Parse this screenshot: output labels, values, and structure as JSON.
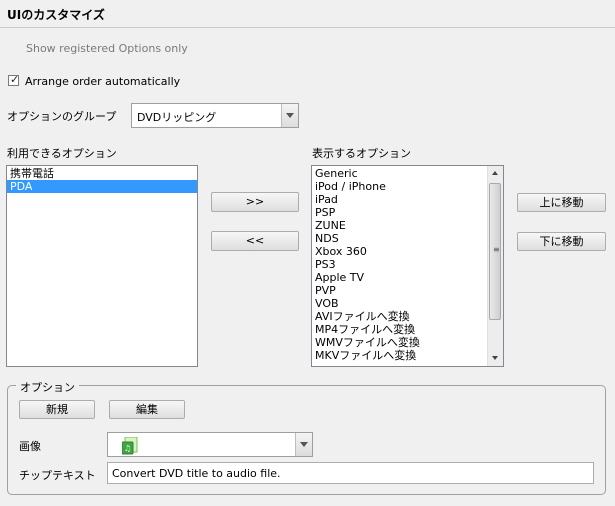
{
  "header": {
    "title": "UIのカスタマイズ"
  },
  "show_registered_label": "Show registered Options only",
  "arrange_checkbox": {
    "label": "Arrange order automatically",
    "checked": true
  },
  "option_group": {
    "label": "オプションのグループ",
    "value": "DVDリッピング"
  },
  "available": {
    "label": "利用できるオプション",
    "items": [
      "携帯電話",
      "PDA"
    ],
    "selected_index": 1
  },
  "transfer": {
    "add_label": ">>",
    "remove_label": "<<"
  },
  "displayed": {
    "label": "表示するオプション",
    "items": [
      "Generic",
      "iPod / iPhone",
      "iPad",
      "PSP",
      "ZUNE",
      "NDS",
      "Xbox 360",
      "PS3",
      "Apple TV",
      "PVP",
      "VOB",
      "AVIファイルへ変換",
      "MP4ファイルへ変換",
      "WMVファイルへ変換",
      "MKVファイルへ変換"
    ]
  },
  "move": {
    "up_label": "上に移動",
    "down_label": "下に移動"
  },
  "options_group": {
    "label": "オプション",
    "new_label": "新規",
    "edit_label": "編集",
    "image_label": "画像",
    "tooltip_label": "チップテキスト",
    "tooltip_value": "Convert DVD title to audio file."
  },
  "icons": {
    "image_preview": "green-audio-file-icon"
  },
  "colors": {
    "selection": "#3399ff",
    "background": "#f0f0f0"
  }
}
